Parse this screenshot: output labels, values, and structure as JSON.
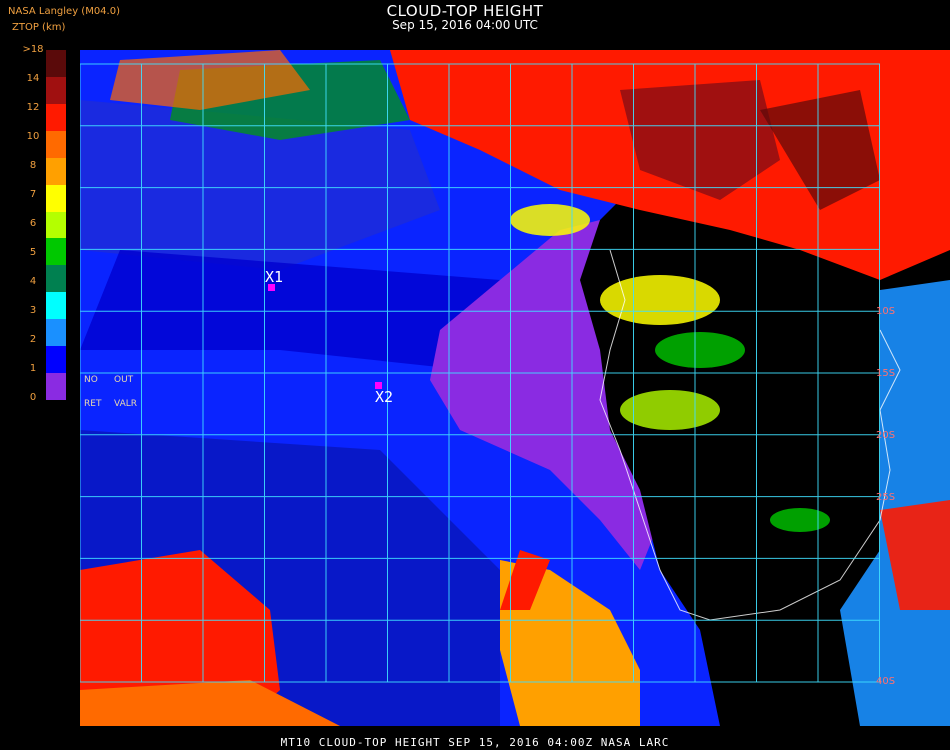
{
  "header": {
    "title": "CLOUD-TOP HEIGHT",
    "datetime": "Sep 15, 2016 04:00 UTC",
    "org": "NASA Langley (M04.0)",
    "param": "ZTOP (km)"
  },
  "legend": {
    "labels": [
      ">18",
      "14",
      "12",
      "10",
      "8",
      "7",
      "6",
      "5",
      "4",
      "3",
      "2",
      "1",
      "0"
    ],
    "colors": [
      "#5a0a0a",
      "#a01010",
      "#ff1a00",
      "#ff6a00",
      "#ffa000",
      "#ffff00",
      "#b4ff00",
      "#00c800",
      "#008050",
      "#00ffff",
      "#1a90ff",
      "#0000ff",
      "#8a2be2"
    ],
    "no_label": "NO",
    "out_label": "OUT",
    "ret_label": "RET",
    "valr_label": "VALR"
  },
  "points": [
    {
      "label": "X1"
    },
    {
      "label": "X2"
    }
  ],
  "lat_labels": [
    "10S",
    "15S",
    "20S",
    "25S",
    "40S"
  ],
  "footer": "MT10  CLOUD-TOP HEIGHT   SEP 15, 2016 04:00Z   NASA LARC"
}
